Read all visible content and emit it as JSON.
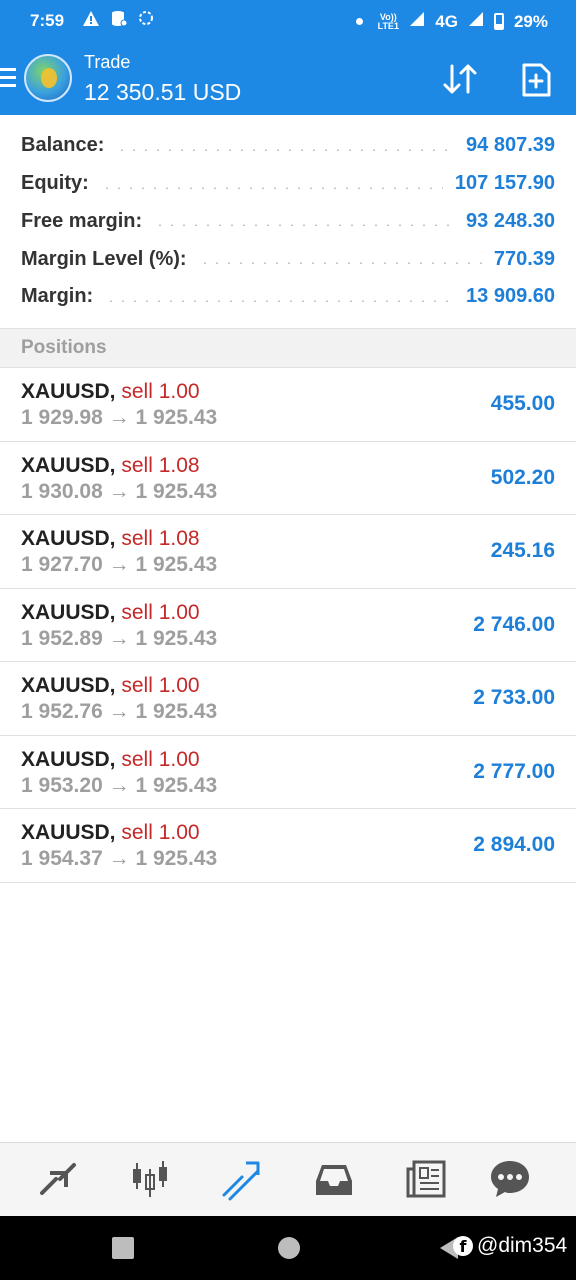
{
  "status_bar": {
    "time": "7:59",
    "network": "4G",
    "volte_label": "Vo)) LTE1",
    "battery": "29%",
    "icons": [
      "warning-icon",
      "storage-icon",
      "sync-icon",
      "dot-icon",
      "volte-icon",
      "signal-icon",
      "signal-icon-2",
      "battery-icon"
    ]
  },
  "app_bar": {
    "title": "Trade",
    "subtitle": "12 350.51 USD",
    "icons": [
      "menu-icon",
      "metatrader-logo",
      "sort-icon",
      "new-order-icon"
    ]
  },
  "account": [
    {
      "label": "Balance:",
      "value": "94 807.39"
    },
    {
      "label": "Equity:",
      "value": "107 157.90"
    },
    {
      "label": "Free margin:",
      "value": "93 248.30"
    },
    {
      "label": "Margin Level (%):",
      "value": "770.39"
    },
    {
      "label": "Margin:",
      "value": "13 909.60"
    }
  ],
  "positions_header": "Positions",
  "positions": [
    {
      "symbol": "XAUUSD,",
      "type": "sell 1.00",
      "open": "1 929.98",
      "arrow": "→",
      "current": "1 925.43",
      "profit": "455.00"
    },
    {
      "symbol": "XAUUSD,",
      "type": "sell 1.08",
      "open": "1 930.08",
      "arrow": "→",
      "current": "1 925.43",
      "profit": "502.20"
    },
    {
      "symbol": "XAUUSD,",
      "type": "sell 1.08",
      "open": "1 927.70",
      "arrow": "→",
      "current": "1 925.43",
      "profit": "245.16"
    },
    {
      "symbol": "XAUUSD,",
      "type": "sell 1.00",
      "open": "1 952.89",
      "arrow": "→",
      "current": "1 925.43",
      "profit": "2 746.00"
    },
    {
      "symbol": "XAUUSD,",
      "type": "sell 1.00",
      "open": "1 952.76",
      "arrow": "→",
      "current": "1 925.43",
      "profit": "2 733.00"
    },
    {
      "symbol": "XAUUSD,",
      "type": "sell 1.00",
      "open": "1 953.20",
      "arrow": "→",
      "current": "1 925.43",
      "profit": "2 777.00"
    },
    {
      "symbol": "XAUUSD,",
      "type": "sell 1.00",
      "open": "1 954.37",
      "arrow": "→",
      "current": "1 925.43",
      "profit": "2 894.00"
    }
  ],
  "bottom_nav": {
    "items": [
      "quotes-icon",
      "chart-icon",
      "trade-icon",
      "history-icon",
      "news-icon",
      "chat-icon"
    ],
    "active": "trade-icon"
  },
  "watermark": "@dim354",
  "colors": {
    "primary": "#1e88e5",
    "value_blue": "#1e7fd8",
    "sell_red": "#c62828",
    "muted_gray": "#9e9e9e",
    "nav_icon": "#555555"
  }
}
